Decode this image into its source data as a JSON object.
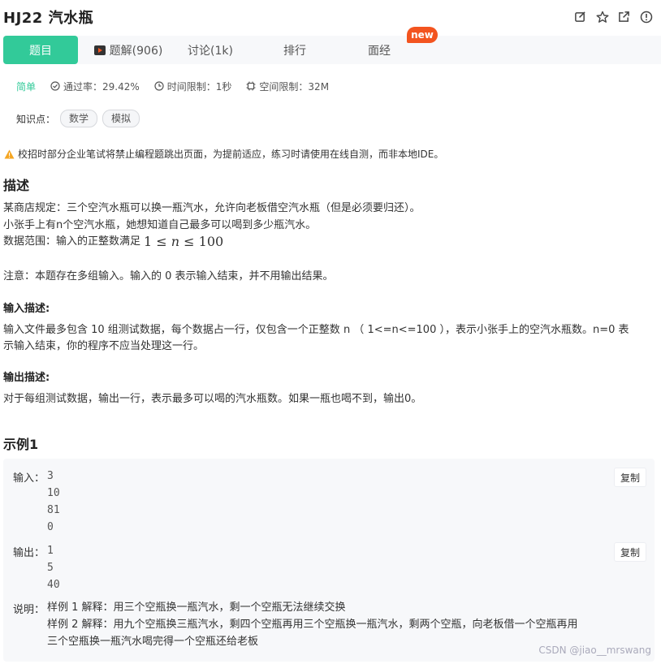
{
  "header": {
    "title": "HJ22 汽水瓶",
    "icons": [
      "edit-icon",
      "star-icon",
      "share-icon",
      "info-icon"
    ]
  },
  "tabs": [
    {
      "label": "题目",
      "active": true
    },
    {
      "label": "题解(906)",
      "icon": "video-icon"
    },
    {
      "label": "讨论(1k)"
    },
    {
      "label": "排行"
    },
    {
      "label": "面经",
      "badge": "new"
    }
  ],
  "meta": {
    "difficulty": "简单",
    "pass_rate": "通过率：29.42%",
    "time_limit": "时间限制：1秒",
    "space_limit": "空间限制：32M"
  },
  "knowledge": {
    "label": "知识点：",
    "tags": [
      "数学",
      "模拟"
    ]
  },
  "warning": "校招时部分企业笔试将禁止编程题跳出页面，为提前适应，练习时请使用在线自测，而非本地IDE。",
  "description": {
    "heading": "描述",
    "line1": "某商店规定：三个空汽水瓶可以换一瓶汽水，允许向老板借空汽水瓶（但是必须要归还）。",
    "line2": "小张手上有n个空汽水瓶，她想知道自己最多可以喝到多少瓶汽水。",
    "line3_prefix": "数据范围：输入的正整数满足",
    "line3_math_lo": "1",
    "line3_math_var": "n",
    "line3_math_hi": "100",
    "note": "注意：本题存在多组输入。输入的 0 表示输入结束，并不用输出结果。"
  },
  "input_desc": {
    "heading": "输入描述:",
    "line1": "输入文件最多包含 10 组测试数据，每个数据占一行，仅包含一个正整数 n （ 1<=n<=100 ），表示小张手上的空汽水瓶数。n=0 表",
    "line2": "示输入结束，你的程序不应当处理这一行。"
  },
  "output_desc": {
    "heading": "输出描述:",
    "line1": "对于每组测试数据，输出一行，表示最多可以喝的汽水瓶数。如果一瓶也喝不到，输出0。"
  },
  "example": {
    "heading": "示例1",
    "input_label": "输入：",
    "input_lines": [
      "3",
      "10",
      "81",
      "0"
    ],
    "output_label": "输出：",
    "output_lines": [
      "1",
      "5",
      "40"
    ],
    "copy_label": "复制",
    "explain_label": "说明：",
    "explain1": "样例 1 解释：用三个空瓶换一瓶汽水，剩一个空瓶无法继续交换",
    "explain2": "样例 2 解释：用九个空瓶换三瓶汽水，剩四个空瓶再用三个空瓶换一瓶汽水，剩两个空瓶，向老板借一个空瓶再用",
    "explain3": "三个空瓶换一瓶汽水喝完得一个空瓶还给老板"
  },
  "watermark": "CSDN @jiao__mrswang",
  "colors": {
    "accent": "#32ca99",
    "badge": "#f3541f",
    "warning": "#f5a623"
  }
}
